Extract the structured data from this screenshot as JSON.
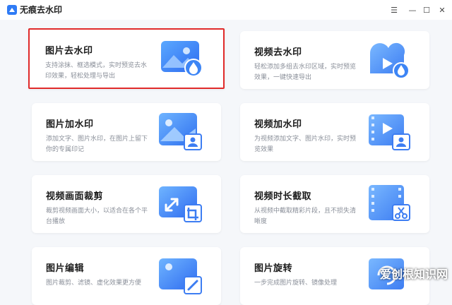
{
  "window": {
    "title": "无痕去水印",
    "controls": {
      "menu": "☰",
      "minimize": "—",
      "maximize": "☐",
      "close": "✕"
    }
  },
  "cards": [
    {
      "title": "图片去水印",
      "desc": "支持涂抹、框选模式，实时预览去水印效果，轻松处理与导出",
      "icon": "image-remove-watermark-icon",
      "selected": true
    },
    {
      "title": "视频去水印",
      "desc": "轻松添加多组去水印区域，实时预览效果，一键快速导出",
      "icon": "video-remove-watermark-icon",
      "selected": false
    },
    {
      "title": "图片加水印",
      "desc": "添加文字、图片水印，在图片上留下你的专属印记",
      "icon": "image-add-watermark-icon",
      "selected": false
    },
    {
      "title": "视频加水印",
      "desc": "为视频添加文字、图片水印，实时预览效果",
      "icon": "video-add-watermark-icon",
      "selected": false
    },
    {
      "title": "视频画面裁剪",
      "desc": "裁剪视频画面大小，以适合在各个平台播放",
      "icon": "video-crop-icon",
      "selected": false
    },
    {
      "title": "视频时长截取",
      "desc": "从视频中截取精彩片段，且不损失清晰度",
      "icon": "video-trim-icon",
      "selected": false
    },
    {
      "title": "图片编辑",
      "desc": "图片裁剪、滤镜、虚化效果更方便",
      "icon": "image-edit-icon",
      "selected": false
    },
    {
      "title": "图片旋转",
      "desc": "一步完成图片旋转、镜像处理",
      "icon": "image-rotate-icon",
      "selected": false
    }
  ],
  "watermark": "爱创根知识网",
  "colors": {
    "accent": "#3b7cf0",
    "selected_border": "#e02a2a"
  }
}
